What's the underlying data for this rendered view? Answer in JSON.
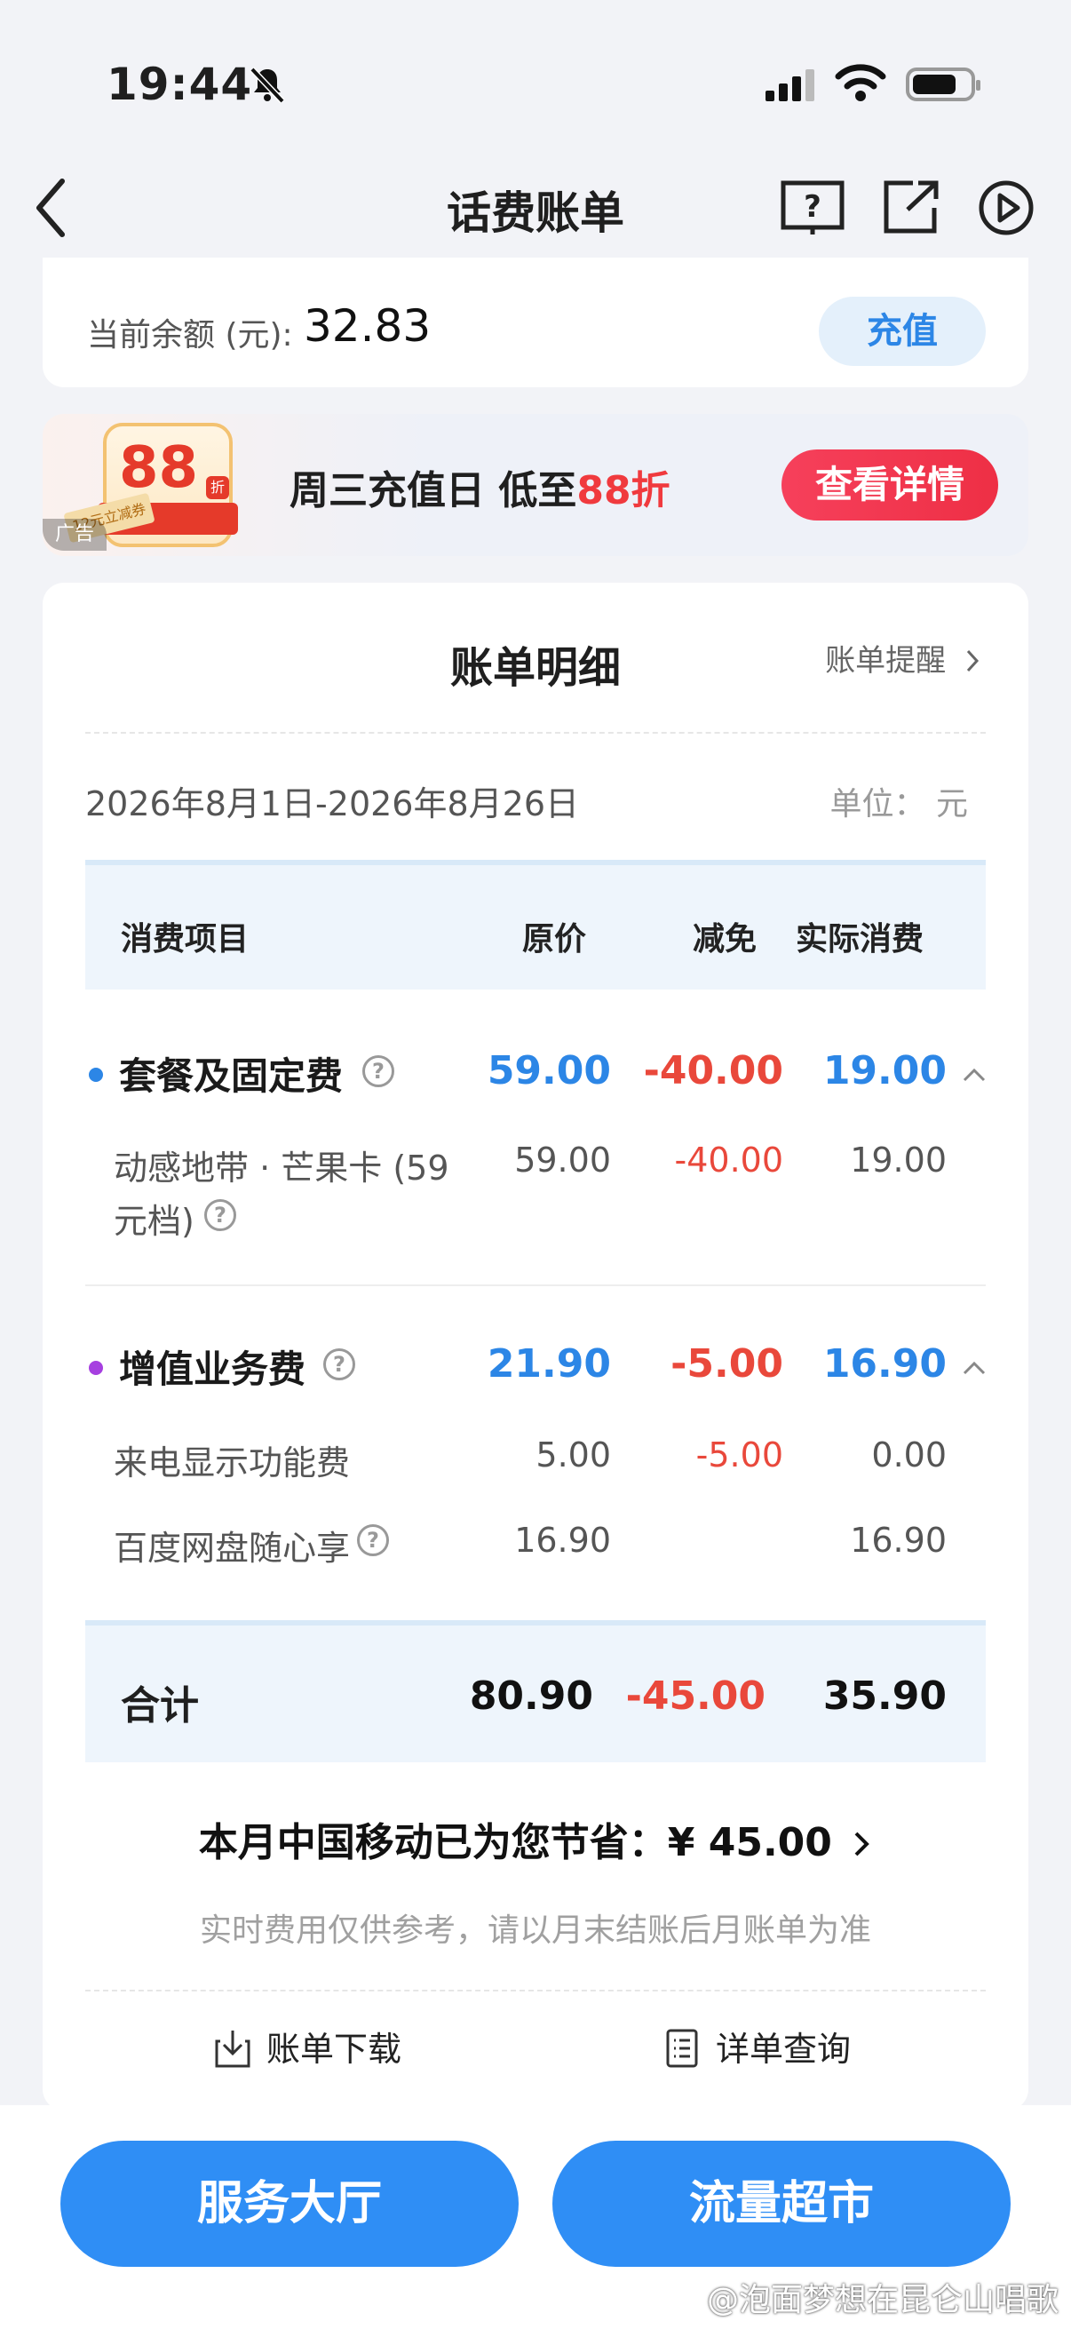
{
  "status": {
    "time": "19:44"
  },
  "nav": {
    "title": "话费账单"
  },
  "balance": {
    "label": "当前余额 (元):",
    "value": "32.83",
    "recharge": "充值"
  },
  "ad": {
    "badge": "88",
    "badge_zhe": "折",
    "coupon": "12元立减券",
    "tag": "广告",
    "text_main": "周三充值日 低至",
    "text_hl": "88折",
    "button": "查看详情"
  },
  "bill": {
    "title": "账单明细",
    "remind": "账单提醒",
    "period": "2026年8月1日-2026年8月26日",
    "unit": "单位： 元",
    "headers": {
      "item": "消费项目",
      "orig": "原价",
      "disc": "减免",
      "actual": "实际消费"
    },
    "categories": [
      {
        "name": "套餐及固定费",
        "orig": "59.00",
        "disc": "-40.00",
        "actual": "19.00",
        "dot": "#2c86e6",
        "items": [
          {
            "name1": "动感地带 · 芒果卡 (59",
            "name2": "元档)",
            "orig": "59.00",
            "disc": "-40.00",
            "actual": "19.00"
          }
        ]
      },
      {
        "name": "增值业务费",
        "orig": "21.90",
        "disc": "-5.00",
        "actual": "16.90",
        "dot": "#a63fe0",
        "items": [
          {
            "name": "来电显示功能费",
            "orig": "5.00",
            "disc": "-5.00",
            "actual": "0.00"
          },
          {
            "name": "百度网盘随心享",
            "orig": "16.90",
            "disc": "",
            "actual": "16.90"
          }
        ]
      }
    ],
    "total": {
      "label": "合计",
      "orig": "80.90",
      "disc": "-45.00",
      "actual": "35.90"
    },
    "saving": "本月中国移动已为您节省：¥ 45.00",
    "note": "实时费用仅供参考，请以月末结账后月账单为准",
    "download": "账单下载",
    "detail": "详单查询"
  },
  "bottom": {
    "left": "服务大厅",
    "right": "流量超市"
  },
  "watermark": "@泡面梦想在昆仑山唱歌",
  "colors": {
    "accent": "#2f8ef5",
    "discount": "#e9483b",
    "ad_red": "#f03a3e"
  }
}
